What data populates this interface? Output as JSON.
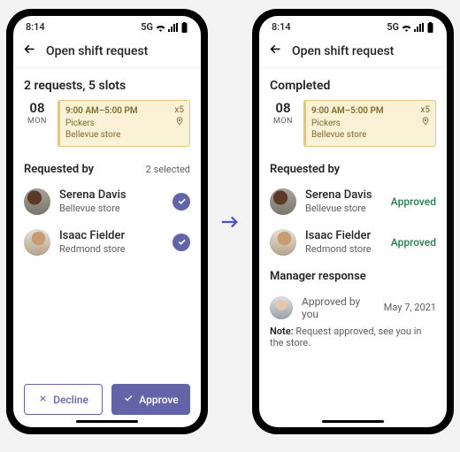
{
  "statusbar": {
    "time": "8:14",
    "net": "5G"
  },
  "header": {
    "title": "Open shift request"
  },
  "left": {
    "summary": "2 requests, 5 slots",
    "date": {
      "num": "08",
      "dow": "MON"
    },
    "shift": {
      "time": "9:00 AM–5:00 PM",
      "role": "Pickers",
      "location": "Bellevue store",
      "slots": "x5"
    },
    "requested_by": {
      "title": "Requested by",
      "selected": "2 selected"
    },
    "people": [
      {
        "name": "Serena Davis",
        "loc": "Bellevue store"
      },
      {
        "name": "Isaac Fielder",
        "loc": "Redmond store"
      }
    ],
    "buttons": {
      "decline": "Decline",
      "approve": "Approve"
    }
  },
  "right": {
    "summary": "Completed",
    "date": {
      "num": "08",
      "dow": "MON"
    },
    "shift": {
      "time": "9:00 AM–5:00 PM",
      "role": "Pickers",
      "location": "Bellevue store",
      "slots": "x5"
    },
    "requested_by": {
      "title": "Requested by"
    },
    "people": [
      {
        "name": "Serena Davis",
        "loc": "Bellevue store",
        "status": "Approved"
      },
      {
        "name": "Isaac Fielder",
        "loc": "Redmond store",
        "status": "Approved"
      }
    ],
    "manager": {
      "title": "Manager response",
      "text": "Approved by you",
      "date": "May 7, 2021",
      "note_label": "Note:",
      "note_text": "Request approved, see you in the store."
    }
  }
}
